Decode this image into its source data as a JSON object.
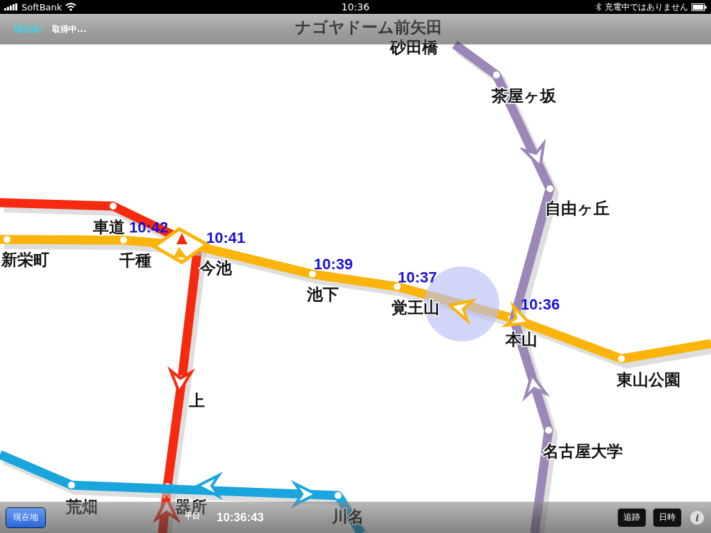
{
  "status_bar": {
    "carrier": "SoftBank",
    "time": "10:36",
    "battery_text": "充電中ではありません"
  },
  "nav_bar": {
    "location_label": "現在地:",
    "location_value": "取得中..."
  },
  "map": {
    "lines": [
      {
        "color": "#f52a10",
        "stations": [
          "車道",
          "上",
          "器所"
        ]
      },
      {
        "color": "#fbb40a",
        "stations": [
          "新栄町",
          "千種",
          "今池",
          "池下",
          "覚王山",
          "本山",
          "東山公園"
        ]
      },
      {
        "color": "#9b87b8",
        "stations": [
          "ナゴヤドーム前矢田",
          "砂田橋",
          "茶屋ヶ坂",
          "自由ヶ丘",
          "名古屋大学"
        ]
      },
      {
        "color": "#1aa6dc",
        "stations": [
          "荒畑",
          "川名"
        ]
      }
    ],
    "times": [
      "10:42",
      "10:41",
      "10:39",
      "10:37",
      "10:36"
    ]
  },
  "toolbar": {
    "location_button": "現在地",
    "day_type": "平日",
    "clock": "10:36:43",
    "buttons": [
      "追跡",
      "日時"
    ],
    "info": "i"
  }
}
